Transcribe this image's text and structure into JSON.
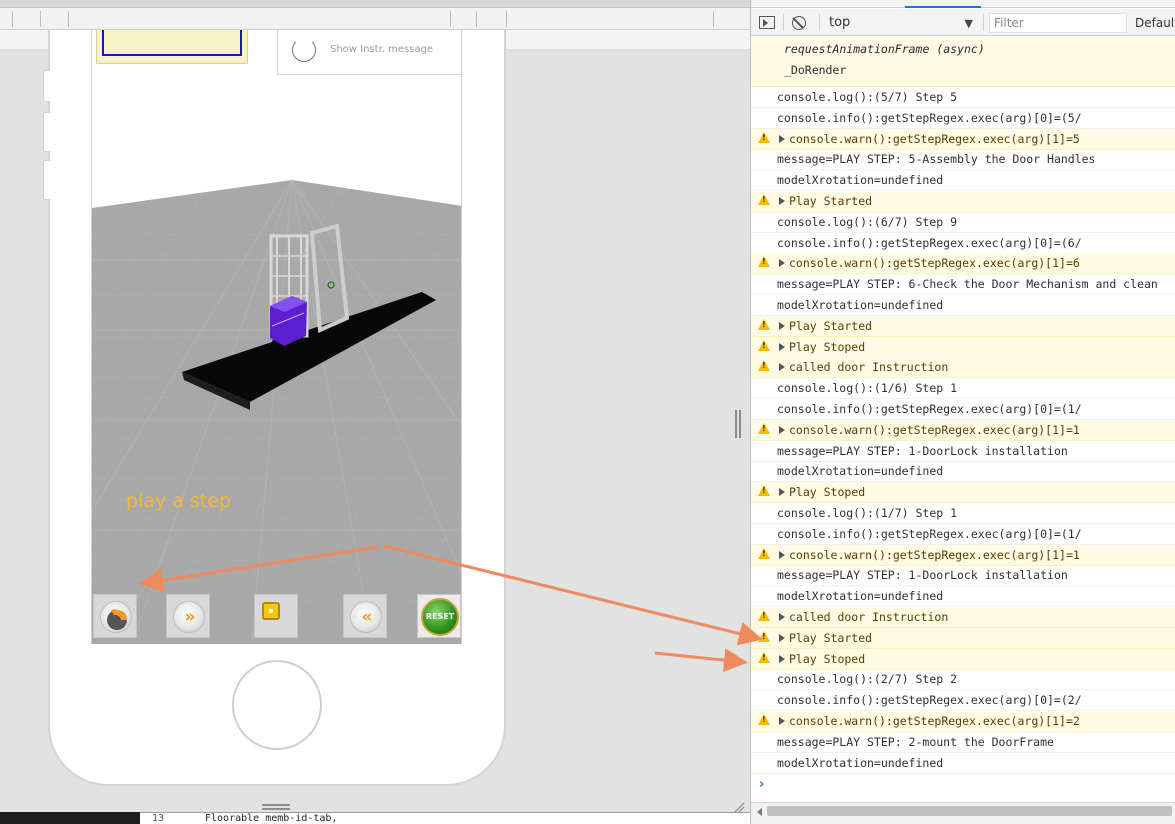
{
  "screen": {
    "instr_label": "Show Instr. message",
    "play_step_text": "play a step",
    "reset_label": "RESET",
    "controls": [
      {
        "name": "play-step",
        "glyph": "▶"
      },
      {
        "name": "forward",
        "glyph": "»"
      },
      {
        "name": "stop",
        "glyph": ""
      },
      {
        "name": "rewind",
        "glyph": "«"
      },
      {
        "name": "reset",
        "glyph": ""
      }
    ]
  },
  "editor": {
    "line_number": "13",
    "code_fragment": "Floorable          memb-id-tab,"
  },
  "console": {
    "context": "top",
    "filter_placeholder": "Filter",
    "levels": "Default",
    "stack_lines": [
      "requestAnimationFrame (async)",
      "_DoRender"
    ],
    "messages": [
      {
        "type": "log",
        "text": "console.log():(5/7) Step 5"
      },
      {
        "type": "log",
        "text": "console.info():getStepRegex.exec(arg)[0]=(5/"
      },
      {
        "type": "warn",
        "text": "console.warn():getStepRegex.exec(arg)[1]=5"
      },
      {
        "type": "log",
        "text": "message=PLAY STEP: 5-Assembly the Door Handles"
      },
      {
        "type": "log",
        "text": "modelXrotation=undefined"
      },
      {
        "type": "warn",
        "text": "Play Started"
      },
      {
        "type": "log",
        "text": "console.log():(6/7) Step 9"
      },
      {
        "type": "log",
        "text": "console.info():getStepRegex.exec(arg)[0]=(6/"
      },
      {
        "type": "warn",
        "text": "console.warn():getStepRegex.exec(arg)[1]=6"
      },
      {
        "type": "log",
        "text": "message=PLAY STEP: 6-Check the Door Mechanism and clean"
      },
      {
        "type": "log",
        "text": "modelXrotation=undefined"
      },
      {
        "type": "warn",
        "text": "Play Started"
      },
      {
        "type": "warn",
        "text": "Play Stoped"
      },
      {
        "type": "warn",
        "text": "called door Instruction"
      },
      {
        "type": "log",
        "text": "console.log():(1/6) Step 1"
      },
      {
        "type": "log",
        "text": "console.info():getStepRegex.exec(arg)[0]=(1/"
      },
      {
        "type": "warn",
        "text": "console.warn():getStepRegex.exec(arg)[1]=1"
      },
      {
        "type": "log",
        "text": "message=PLAY STEP: 1-DoorLock installation"
      },
      {
        "type": "log",
        "text": "modelXrotation=undefined"
      },
      {
        "type": "warn",
        "text": "Play Stoped"
      },
      {
        "type": "log",
        "text": "console.log():(1/7) Step 1"
      },
      {
        "type": "log",
        "text": "console.info():getStepRegex.exec(arg)[0]=(1/"
      },
      {
        "type": "warn",
        "text": "console.warn():getStepRegex.exec(arg)[1]=1"
      },
      {
        "type": "log",
        "text": "message=PLAY STEP: 1-DoorLock installation"
      },
      {
        "type": "log",
        "text": "modelXrotation=undefined"
      },
      {
        "type": "warn",
        "text": "called door Instruction"
      },
      {
        "type": "warn",
        "text": "Play Started"
      },
      {
        "type": "warn",
        "text": "Play Stoped"
      },
      {
        "type": "log",
        "text": "console.log():(2/7) Step 2"
      },
      {
        "type": "log",
        "text": "console.info():getStepRegex.exec(arg)[0]=(2/"
      },
      {
        "type": "warn",
        "text": "console.warn():getStepRegex.exec(arg)[1]=2"
      },
      {
        "type": "log",
        "text": "message=PLAY STEP: 2-mount the DoorFrame"
      },
      {
        "type": "log",
        "text": "modelXrotation=undefined"
      }
    ]
  },
  "colors": {
    "annotation_arrow": "#ee8a5f",
    "play_step_text": "#f0bb34",
    "warn_bg": "#fffbe5",
    "warn_icon": "#f5bd00",
    "model_purple": "#5b1fcf",
    "floor_gray": "#a6a6a6"
  },
  "icons": {
    "toolbar": [
      "sidebar-toggle-icon",
      "clear-console-icon",
      "dropdown-arrow-icon"
    ],
    "rows": [
      "warning-icon",
      "expand-arrow-icon"
    ]
  }
}
